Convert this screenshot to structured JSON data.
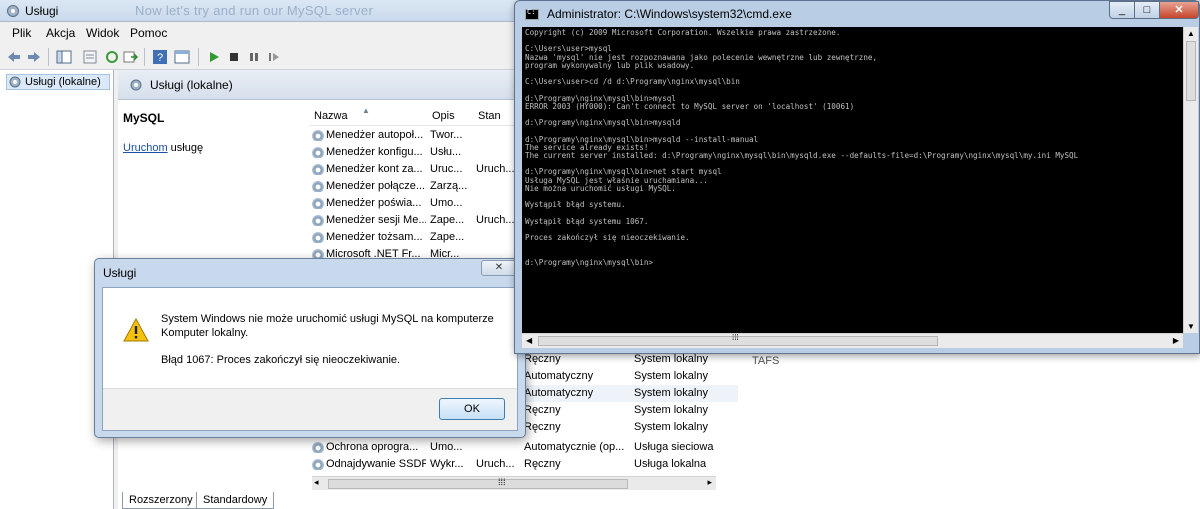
{
  "services": {
    "window_title": "Usługi",
    "ghost_title": "Now let's try and run our MySQL server",
    "menu": [
      "Plik",
      "Akcja",
      "Widok",
      "Pomoc"
    ],
    "tree_node": "Usługi (lokalne)",
    "header_title": "Usługi (lokalne)",
    "detail_title": "MySQL",
    "start_link": "Uruchom",
    "start_suffix": " usługę",
    "columns": {
      "name": "Nazwa",
      "desc": "Opis",
      "state": "Stan"
    },
    "rows": [
      {
        "name": "Menedżer autopoł...",
        "desc": "Twor...",
        "state": "",
        "type": "",
        "logon": ""
      },
      {
        "name": "Menedżer konfigu...",
        "desc": "Usłu...",
        "state": "",
        "type": "",
        "logon": ""
      },
      {
        "name": "Menedżer kont za...",
        "desc": "Uruc...",
        "state": "Uruch...",
        "type": "",
        "logon": ""
      },
      {
        "name": "Menedżer połącze...",
        "desc": "Zarzą...",
        "state": "",
        "type": "",
        "logon": ""
      },
      {
        "name": "Menedżer poświa...",
        "desc": "Umo...",
        "state": "",
        "type": "",
        "logon": ""
      },
      {
        "name": "Menedżer sesji Me...",
        "desc": "Zape...",
        "state": "Uruch...",
        "type": "",
        "logon": ""
      },
      {
        "name": "Menedżer tożsam...",
        "desc": "Zape...",
        "state": "",
        "type": "",
        "logon": ""
      },
      {
        "name": "Microsoft .NET Fr...",
        "desc": "Micr...",
        "state": "",
        "type": "",
        "logon": ""
      },
      {
        "name": "",
        "desc": "",
        "state": "",
        "type": "Ręczny",
        "logon": "System lokalny"
      },
      {
        "name": "",
        "desc": "",
        "state": "",
        "type": "Automatyczny",
        "logon": "System lokalny"
      },
      {
        "name": "",
        "desc": "",
        "state": "",
        "type": "Automatyczny",
        "logon": "System lokalny"
      },
      {
        "name": "",
        "desc": "",
        "state": "",
        "type": "Ręczny",
        "logon": "System lokalny"
      },
      {
        "name": "",
        "desc": "",
        "state": "",
        "type": "Ręczny",
        "logon": "System lokalny"
      },
      {
        "name": "Ochrona oprogra...",
        "desc": "Umo...",
        "state": "",
        "type": "Automatycznie (op...",
        "logon": "Usługa sieciowa"
      },
      {
        "name": "Odnajdywanie SSDP",
        "desc": "Wykr...",
        "state": "Uruch...",
        "type": "Ręczny",
        "logon": "Usługa lokalna"
      }
    ],
    "tabs": [
      "Rozszerzony",
      "Standardowy"
    ],
    "right_fragment": "TAFS"
  },
  "dialog": {
    "title": "Usługi",
    "close_label": "✕",
    "message_line1": "System Windows nie może uruchomić usługi MySQL na komputerze Komputer lokalny.",
    "message_line2": "Błąd 1067: Proces zakończył się nieoczekiwanie.",
    "ok_label": "OK"
  },
  "cmd": {
    "title": "Administrator: C:\\Windows\\system32\\cmd.exe",
    "output": "Copyright (c) 2009 Microsoft Corporation. Wszelkie prawa zastrzeżone.\n\nC:\\Users\\user>mysql\nNazwa 'mysql' nie jest rozpoznawana jako polecenie wewnętrzne lub zewnętrzne,\nprogram wykonywalny lub plik wsadowy.\n\nC:\\Users\\user>cd /d d:\\Programy\\nginx\\mysql\\bin\n\nd:\\Programy\\nginx\\mysql\\bin>mysql\nERROR 2003 (HY000): Can't connect to MySQL server on 'localhost' (10061)\n\nd:\\Programy\\nginx\\mysql\\bin>mysqld\n\nd:\\Programy\\nginx\\mysql\\bin>mysqld --install-manual\nThe service already exists!\nThe current server installed: d:\\Programy\\nginx\\mysql\\bin\\mysqld.exe --defaults-file=d:\\Programy\\nginx\\mysql\\my.ini MySQL\n\nd:\\Programy\\nginx\\mysql\\bin>net start mysql\nUsługa MySQL jest właśnie uruchamiana...\nNie można uruchomić usługi MySQL.\n\nWystąpił błąd systemu.\n\nWystąpił błąd systemu 1067.\n\nProces zakończył się nieoczekiwanie.\n\n\nd:\\Programy\\nginx\\mysql\\bin>"
  },
  "colors": {
    "console_bg": "#000000",
    "console_text": "#c0c0c0",
    "link": "#1f4fa5",
    "close_button": "#c7452b"
  }
}
